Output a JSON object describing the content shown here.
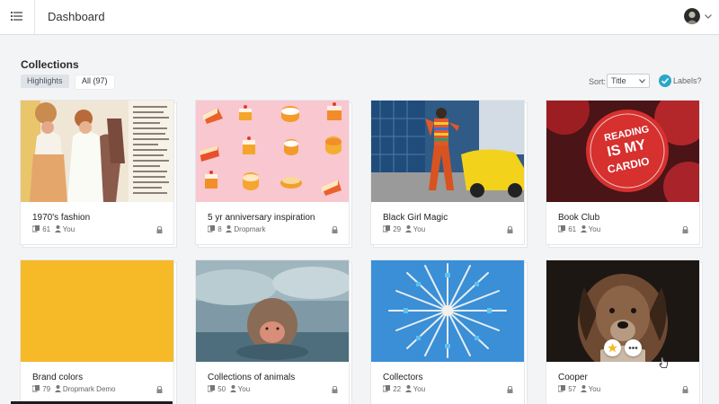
{
  "header": {
    "title": "Dashboard"
  },
  "section": {
    "title": "Collections"
  },
  "filters": {
    "highlights": "Highlights",
    "all": "All (97)"
  },
  "sort": {
    "label": "Sort:",
    "value": "Title"
  },
  "labels": {
    "text": "Labels?"
  },
  "colors": {
    "accent": "#2aa6c9",
    "brand_swatch": "#f6b928",
    "star": "#f6b928"
  },
  "collections": [
    {
      "title": "1970's fashion",
      "count": "61",
      "owner": "You"
    },
    {
      "title": "5 yr anniversary inspiration",
      "count": "8",
      "owner": "Dropmark"
    },
    {
      "title": "Black Girl Magic",
      "count": "29",
      "owner": "You"
    },
    {
      "title": "Book Club",
      "count": "61",
      "owner": "You"
    },
    {
      "title": "Brand colors",
      "count": "79",
      "owner": "Dropmark Demo"
    },
    {
      "title": "Collections of animals",
      "count": "50",
      "owner": "You"
    },
    {
      "title": "Collectors",
      "count": "22",
      "owner": "You"
    },
    {
      "title": "Cooper",
      "count": "57",
      "owner": "You"
    }
  ],
  "book_club_art": {
    "line1": "READING",
    "line2": "IS MY",
    "line3": "CARDIO"
  },
  "icons": [
    "menu-icon",
    "avatar",
    "chevron-down-icon",
    "labels-icon",
    "items-icon",
    "user-icon",
    "lock-icon",
    "star-icon",
    "more-icon"
  ]
}
